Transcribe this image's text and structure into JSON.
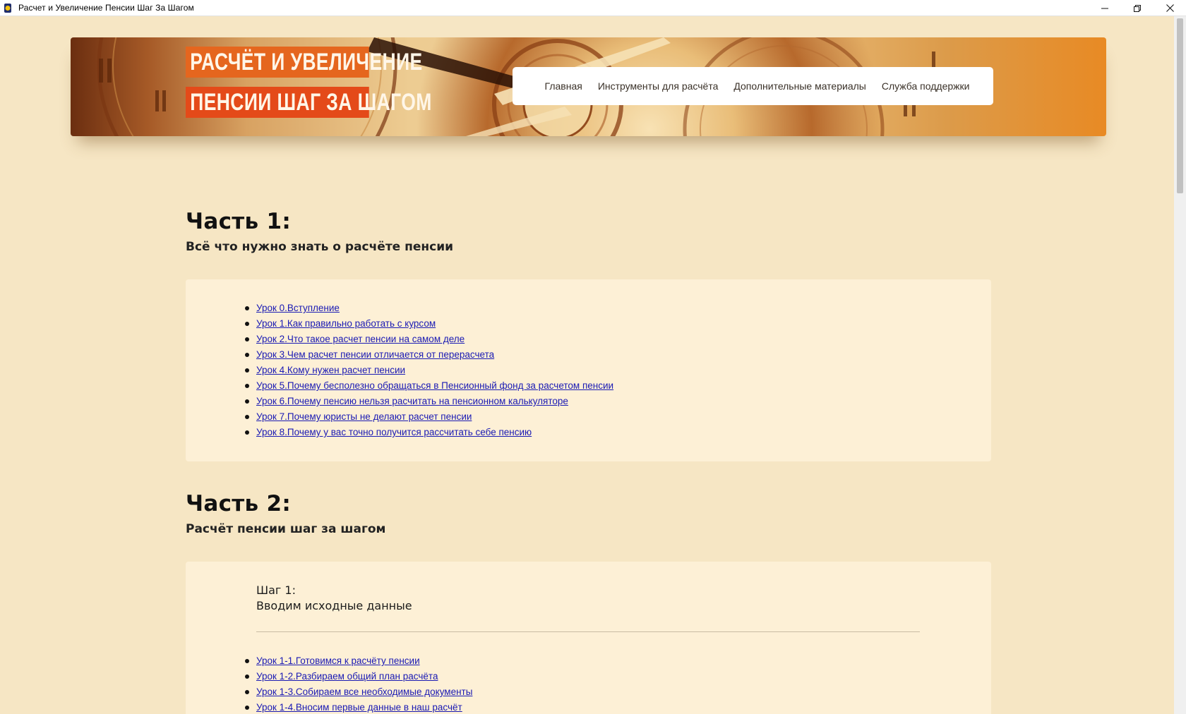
{
  "window": {
    "title": "Расчет и Увеличение Пенсии Шаг За Шагом"
  },
  "header": {
    "logo_line1": "РАСЧЁТ И УВЕЛИЧЕНИЕ",
    "logo_line2": "ПЕНСИИ ШАГ ЗА ШАГОМ",
    "nav": [
      {
        "label": "Главная"
      },
      {
        "label": "Инструменты для расчёта"
      },
      {
        "label": "Дополнительные материалы"
      },
      {
        "label": "Служба поддержки"
      }
    ]
  },
  "part1": {
    "title": "Часть 1:",
    "subtitle": "Всё что нужно знать о расчёте пенсии",
    "lessons": [
      {
        "label": "Урок 0.Вступление"
      },
      {
        "label": "Урок 1.Как правильно работать с курсом"
      },
      {
        "label": "Урок 2.Что такое расчет пенсии на самом деле"
      },
      {
        "label": "Урок 3.Чем расчет пенсии отличается от перерасчета"
      },
      {
        "label": "Урок 4.Кому нужен расчет пенсии"
      },
      {
        "label": "Урок 5.Почему бесполезно обращаться в Пенсионный фонд за расчетом пенсии"
      },
      {
        "label": "Урок 6.Почему пенсию нельзя расчитать на пенсионном калькуляторе"
      },
      {
        "label": "Урок 7.Почему юристы не делают расчет пенсии"
      },
      {
        "label": "Урок 8.Почему у вас точно получится рассчитать себе пенсию"
      }
    ]
  },
  "part2": {
    "title": "Часть 2:",
    "subtitle": "Расчёт пенсии шаг за шагом",
    "step1": {
      "label": "Шаг 1:",
      "title": "Вводим исходные данные",
      "lessons": [
        {
          "label": "Урок 1-1.Готовимся к расчёту пенсии"
        },
        {
          "label": "Урок 1-2.Разбираем общий план расчёта"
        },
        {
          "label": "Урок 1-3.Собираем все необходимые документы"
        },
        {
          "label": "Урок 1-4.Вносим первые данные в наш расчёт"
        }
      ]
    }
  }
}
